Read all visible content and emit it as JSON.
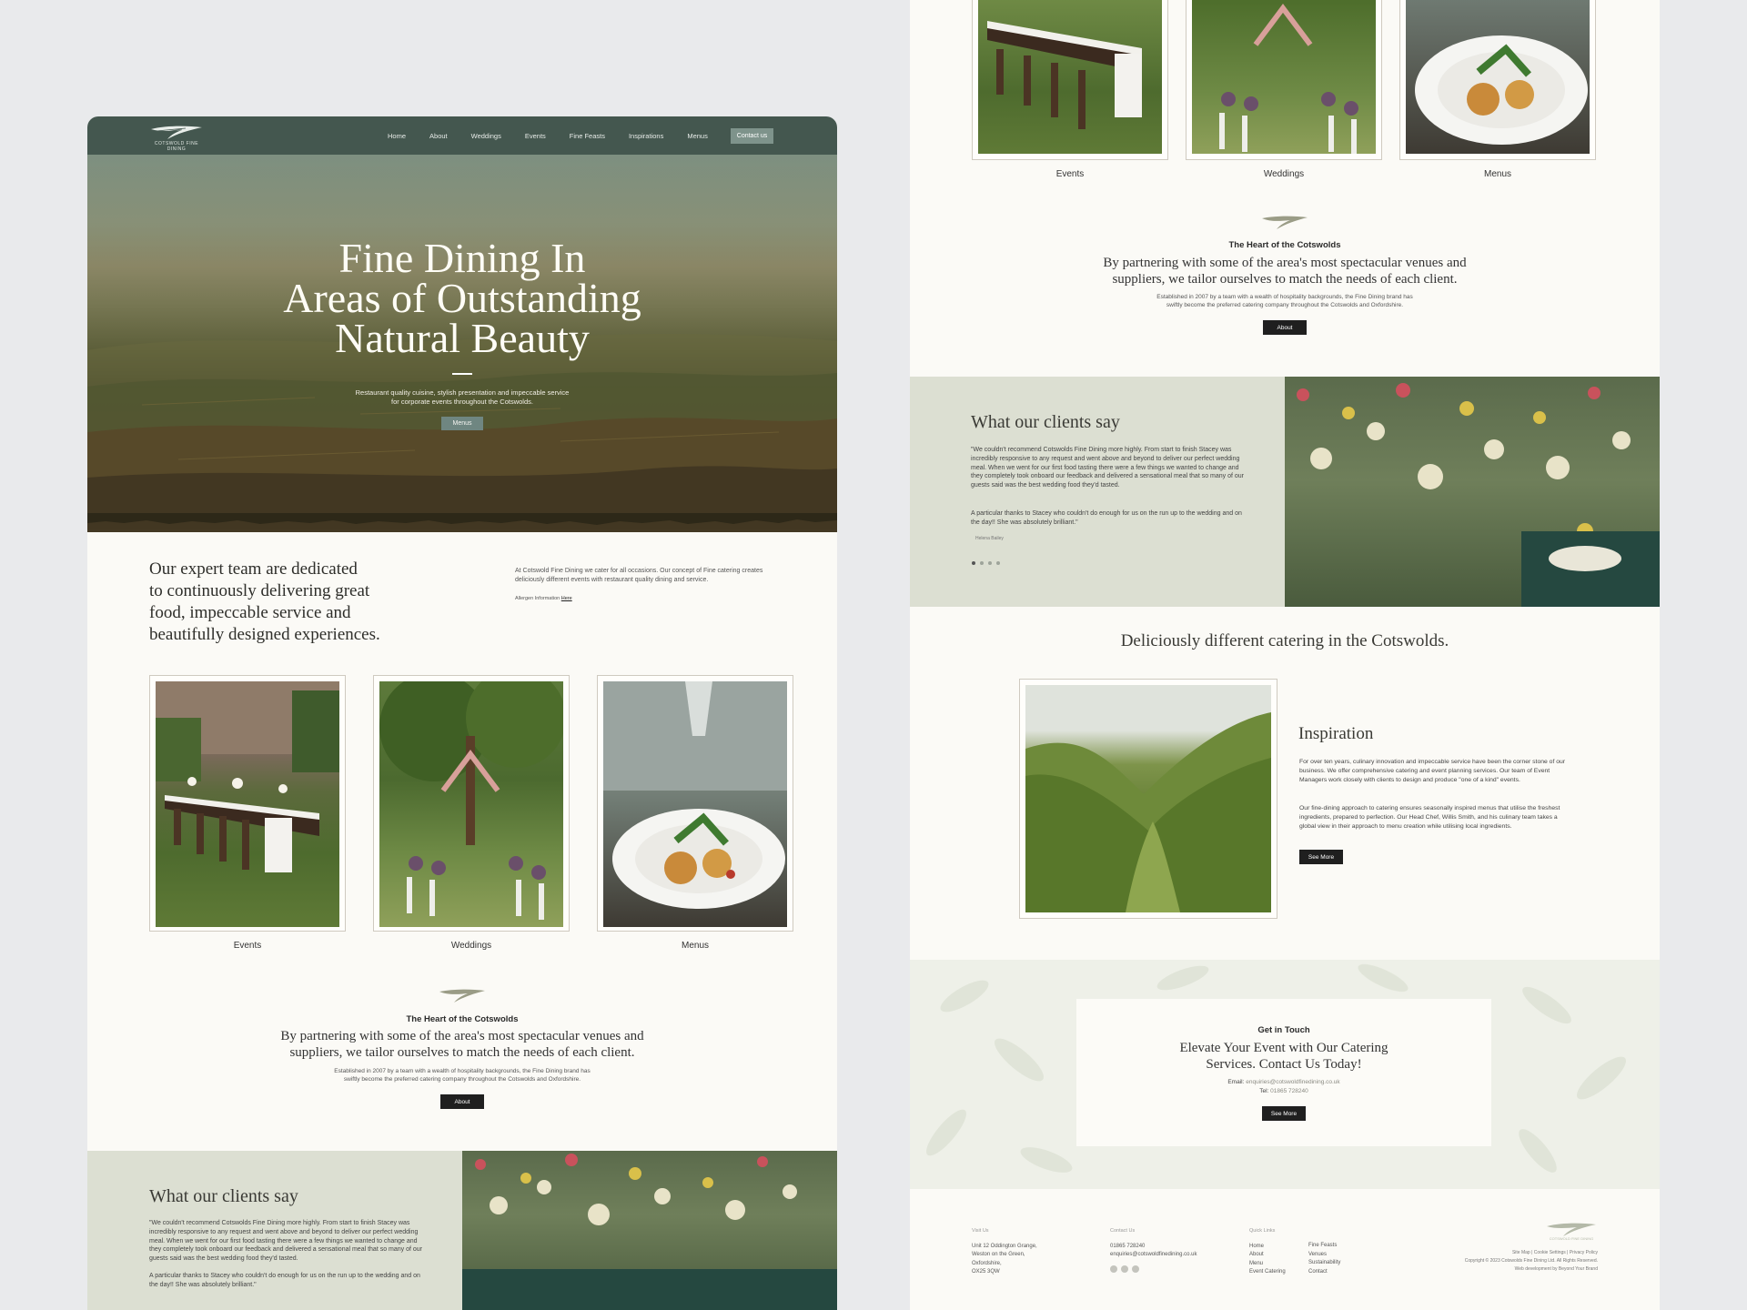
{
  "nav": {
    "logo_text": "COTSWOLD FINE DINING",
    "links": [
      "Home",
      "About",
      "Weddings",
      "Events",
      "Fine Feasts",
      "Inspirations",
      "Menus"
    ],
    "cta": "Contact us"
  },
  "hero": {
    "title_line1": "Fine Dining In",
    "title_line2": "Areas of Outstanding",
    "title_line3": "Natural Beauty",
    "subtitle_line1": "Restaurant quality cuisine, stylish presentation and impeccable service",
    "subtitle_line2": "for corporate events throughout the Cotswolds.",
    "button": "Menus"
  },
  "intro": {
    "heading_line1": "Our expert team are dedicated",
    "heading_line2": "to continuously delivering great",
    "heading_line3": "food, impeccable service and",
    "heading_line4": "beautifully designed experiences.",
    "paragraph": "At Cotswold Fine Dining we cater for all occasions. Our concept of Fine catering creates deliciously different events with restaurant quality dining and service.",
    "allergen_label": "Allergen Information",
    "allergen_link": "Here"
  },
  "cards": [
    "Events",
    "Weddings",
    "Menus"
  ],
  "heart": {
    "title": "The Heart of the Cotswolds",
    "text_line1": "By partnering with some of the area's most spectacular venues and",
    "text_line2": "suppliers, we tailor ourselves to match the needs of each client.",
    "small_line1": "Established in 2007 by a team with a wealth of hospitality backgrounds, the Fine Dining brand has",
    "small_line2": "swiftly become the preferred catering company throughout the Cotswolds and Oxfordshire.",
    "button": "About"
  },
  "testimonials": {
    "title": "What our clients say",
    "quote_p1": "\"We couldn't recommend Cotswolds Fine Dining more highly. From start to finish Stacey was incredibly responsive to any request and went above and beyond to deliver our perfect wedding meal. When we went for our first food tasting there were a few things we wanted to change and they completely took onboard our feedback and delivered a sensational meal that so many of our guests said was the best wedding food they'd tasted.",
    "quote_p2": "A particular thanks to Stacey who couldn't do enough for us on the run up to the wedding and on the day!! She was absolutely brilliant.\"",
    "author": "Helena Bailey"
  },
  "inspiration": {
    "headline": "Deliciously different catering in the Cotswolds.",
    "title": "Inspiration",
    "p1": "For over ten years, culinary innovation and impeccable service have been the corner stone of our business. We offer comprehensive catering and event planning services. Our team of Event Managers work closely with clients to design and produce \"one of a kind\" events.",
    "p2": "Our fine-dining approach to catering ensures seasonally inspired menus that utilise the freshest ingredients, prepared to perfection. Our Head Chef, Willis Smith, and his culinary team takes a global view in their approach to menu creation while utilising local ingredients.",
    "button": "See More"
  },
  "contact": {
    "title": "Get in Touch",
    "text_line1": "Elevate Your Event with Our Catering",
    "text_line2": "Services. Contact Us Today!",
    "email_label": "Email:",
    "email": "enquiries@cotswoldfinedining.co.uk",
    "tel_label": "Tel:",
    "tel": "01865 728240",
    "button": "See More"
  },
  "footer": {
    "visit_head": "Visit Us",
    "address": [
      "Unit 12 Oddington Grange,",
      "Weston on the Green,",
      "Oxfordshire,",
      "OX25 3QW"
    ],
    "contact_head": "Contact Us",
    "phone": "01865 728240",
    "email": "enquiries@cotswoldfinedining.co.uk",
    "quick_head": "Quick Links",
    "quick_col1": [
      "Home",
      "About",
      "Menu",
      "Event Catering"
    ],
    "quick_col2": [
      "Fine Feasts",
      "Venues",
      "Sustainability",
      "Contact"
    ],
    "legal_links": "Site Map  |  Cookie Settings  |  Privacy Policy",
    "copyright": "Copyright © 2023 Cotswolds Fine Dining Ltd. All Rights Reserved.",
    "credit": "Web development by Beyond Your Brand",
    "logo_text": "COTSWOLD FINE DINING"
  },
  "colors": {
    "nav_green": "#44574f",
    "sage_panel": "#dcdfd2",
    "cream": "#fbfaf6",
    "dark_button": "#1f1f1f"
  }
}
